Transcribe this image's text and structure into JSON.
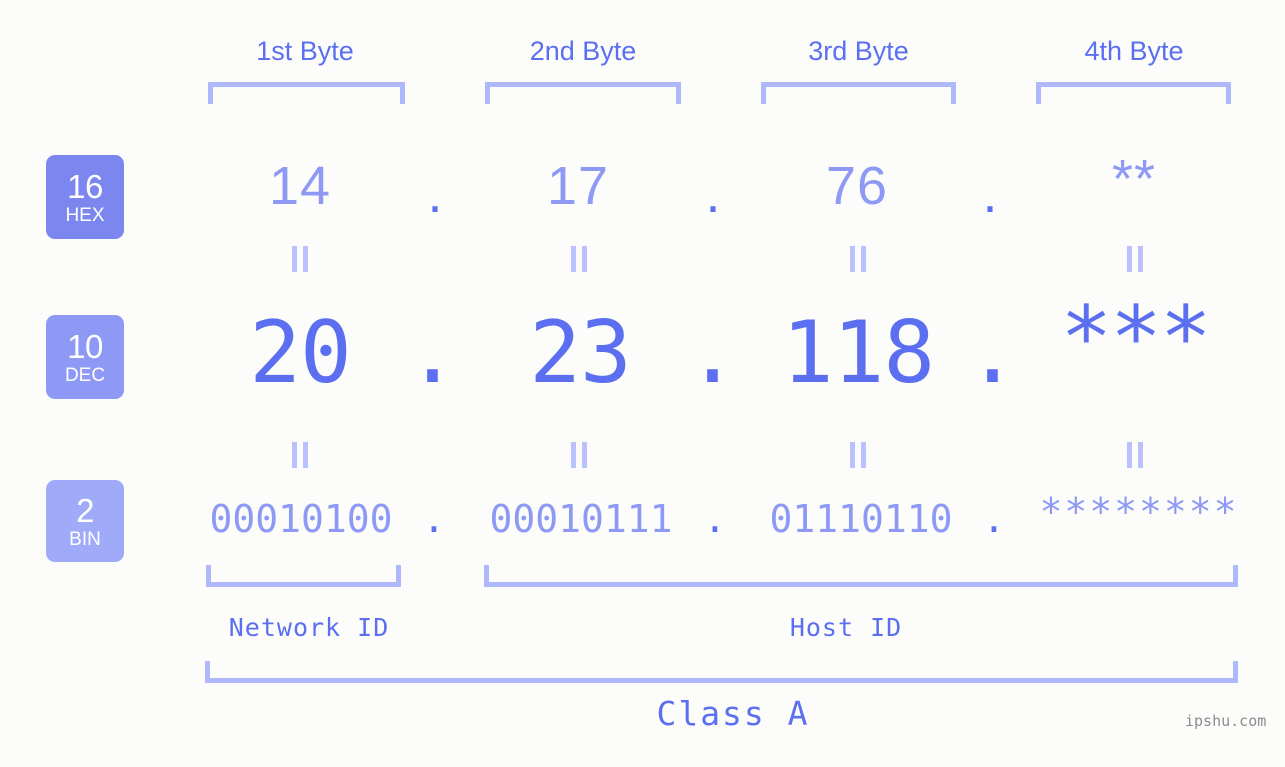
{
  "meta": {
    "watermark": "ipshu.com",
    "background_color": "#fcfdfa",
    "accent_color": "#5b6ff0",
    "accent_light_color": "#8e99f5",
    "bracket_color": "#aeb8fb"
  },
  "byte_headers": [
    {
      "label": "1st Byte"
    },
    {
      "label": "2nd Byte"
    },
    {
      "label": "3rd Byte"
    },
    {
      "label": "4th Byte"
    }
  ],
  "rows": {
    "hex": {
      "badge_number": "16",
      "badge_name": "HEX",
      "badge_color": "#7b86ef",
      "values": [
        "14",
        "17",
        "76",
        "**"
      ],
      "separator": "."
    },
    "dec": {
      "badge_number": "10",
      "badge_name": "DEC",
      "badge_color": "#8e99f5",
      "values": [
        "20",
        "23",
        "118",
        "***"
      ],
      "separator": "."
    },
    "bin": {
      "badge_number": "2",
      "badge_name": "BIN",
      "badge_color": "#9fabf9",
      "values": [
        "00010100",
        "00010111",
        "01110110",
        "********"
      ],
      "separator": "."
    }
  },
  "equals_marks": {
    "symbol": "||",
    "count_per_row": 4
  },
  "id_sections": [
    {
      "label": "Network ID"
    },
    {
      "label": "Host ID"
    }
  ],
  "class_section": {
    "label": "Class A"
  }
}
